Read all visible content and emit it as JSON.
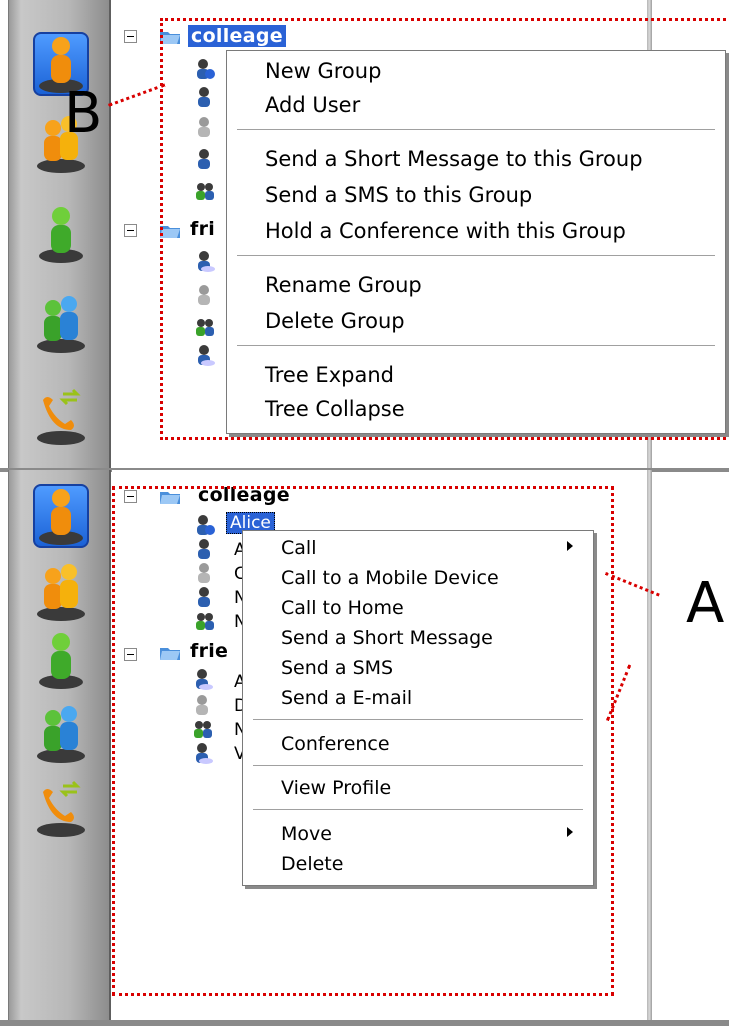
{
  "top_panel": {
    "tree": {
      "group1": {
        "label": "colleage"
      },
      "group2": {
        "label": "fri"
      }
    },
    "context_menu": {
      "items": [
        "New Group",
        "Add User",
        "Send a Short Message to this Group",
        "Send a SMS to this Group",
        "Hold a Conference with this Group",
        "Rename Group",
        "Delete Group",
        "Tree Expand",
        "Tree Collapse"
      ]
    },
    "callout_label": "B"
  },
  "bottom_panel": {
    "tree": {
      "group1": {
        "label": "colleage"
      },
      "selected_user": "Alice",
      "group2": {
        "label": "frie"
      },
      "partial_user_initials": [
        "A",
        "C",
        "N",
        "N",
        "A",
        "D",
        "N",
        "V"
      ]
    },
    "context_menu": {
      "items": [
        "Call",
        "Call to a Mobile Device",
        "Call to Home",
        "Send a Short Message",
        "Send a SMS",
        "Send a E-mail",
        "Conference",
        "View Profile",
        "Move",
        "Delete"
      ]
    },
    "callout_label": "A"
  },
  "colors": {
    "selection_blue": "#2a62d6",
    "annotation_red": "#d80000",
    "sidebar_gray": "#b7b7b7"
  },
  "sidebar_icons": [
    "person-orange-icon",
    "group-orange-icon",
    "person-green-icon",
    "group-blue-icon",
    "phone-transfer-icon"
  ]
}
